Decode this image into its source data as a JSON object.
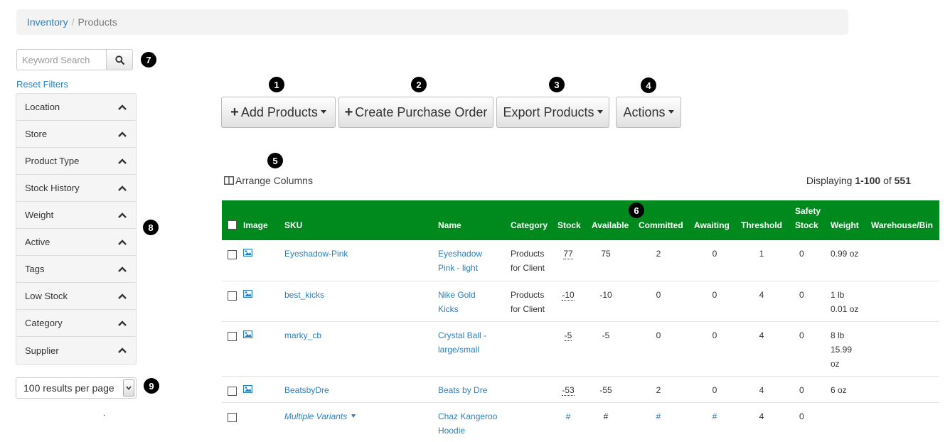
{
  "breadcrumb": {
    "parent": "Inventory",
    "separator": "/",
    "current": "Products"
  },
  "search": {
    "placeholder": "Keyword Search",
    "icon": "search-icon"
  },
  "reset_filters": "Reset Filters",
  "filters": [
    "Location",
    "Store",
    "Product Type",
    "Stock History",
    "Weight",
    "Active",
    "Tags",
    "Low Stock",
    "Category",
    "Supplier"
  ],
  "per_page": "100 results per page",
  "dot": ".",
  "badges": [
    "1",
    "2",
    "3",
    "4",
    "5",
    "6",
    "7",
    "8",
    "9"
  ],
  "toolbar": {
    "add_products": "Add Products",
    "create_po": "Create Purchase Order",
    "export_products": "Export Products",
    "actions": "Actions"
  },
  "arrange_columns": "Arrange Columns",
  "displaying": {
    "prefix": "Displaying",
    "range": "1-100",
    "of": "of",
    "total": "551"
  },
  "table": {
    "header_color": "#008a1e",
    "headers": {
      "image": "Image",
      "sku": "SKU",
      "name": "Name",
      "category": "Category",
      "stock": "Stock",
      "available": "Available",
      "committed": "Committed",
      "awaiting": "Awaiting",
      "threshold": "Threshold",
      "safety_1": "Safety",
      "safety_2": "Stock",
      "weight": "Weight",
      "warehouse": "Warehouse/Bin"
    },
    "rows": [
      {
        "sku": "Eyeshadow-Pink",
        "name_1": "Eyeshadow",
        "name_2": "Pink - light",
        "cat_1": "Products",
        "cat_2": "for Client",
        "stock": "77",
        "available": "75",
        "committed": "2",
        "awaiting": "0",
        "threshold": "1",
        "safety": "0",
        "weight_1": "0.99 oz",
        "weight_2": "",
        "weight_3": ""
      },
      {
        "sku": "best_kicks",
        "name_1": "Nike Gold",
        "name_2": "Kicks",
        "cat_1": "Products",
        "cat_2": "for Client",
        "stock": "-10",
        "available": "-10",
        "committed": "0",
        "awaiting": "0",
        "threshold": "4",
        "safety": "0",
        "weight_1": "1 lb",
        "weight_2": "0.01 oz",
        "weight_3": ""
      },
      {
        "sku": "marky_cb",
        "name_1": "Crystal Ball -",
        "name_2": "large/small",
        "cat_1": "",
        "cat_2": "",
        "stock": "-5",
        "available": "-5",
        "committed": "0",
        "awaiting": "0",
        "threshold": "4",
        "safety": "0",
        "weight_1": "8 lb",
        "weight_2": "15.99",
        "weight_3": "oz"
      },
      {
        "sku": "BeatsbyDre",
        "name_1": "Beats by Dre",
        "name_2": "",
        "cat_1": "",
        "cat_2": "",
        "stock": "-53",
        "available": "-55",
        "committed": "2",
        "awaiting": "0",
        "threshold": "4",
        "safety": "0",
        "weight_1": "6 oz",
        "weight_2": "",
        "weight_3": ""
      },
      {
        "sku": "Multiple Variants",
        "name_1": "Chaz Kangeroo",
        "name_2": "Hoodie",
        "cat_1": "",
        "cat_2": "",
        "stock": "#",
        "available": "#",
        "committed": "#",
        "awaiting": "#",
        "threshold": "4",
        "safety": "0",
        "weight_1": "",
        "weight_2": "",
        "weight_3": ""
      }
    ]
  }
}
